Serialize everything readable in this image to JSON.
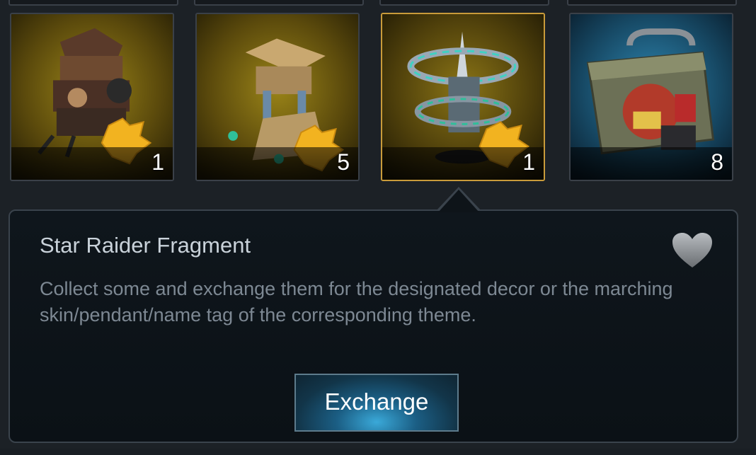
{
  "items": [
    {
      "name": "samurai-castle-fragment",
      "count": "1",
      "background": "#6b5a10"
    },
    {
      "name": "tower-fragment",
      "count": "5",
      "background": "#6b5a10"
    },
    {
      "name": "star-raider-fragment",
      "count": "1",
      "background": "#5a4a0e",
      "selected": true
    },
    {
      "name": "supply-crate",
      "count": "8",
      "background": "#1c4a66"
    }
  ],
  "detail": {
    "title": "Star Raider Fragment",
    "description": "Collect some and exchange them for the designated decor or the marching skin/pendant/name tag of the corresponding theme.",
    "exchange_label": "Exchange",
    "favorite_icon": "heart-icon"
  },
  "colors": {
    "selected_border": "#c99b3a",
    "panel_bg": "#0e1419",
    "button_glow": "#3aa9d9"
  }
}
